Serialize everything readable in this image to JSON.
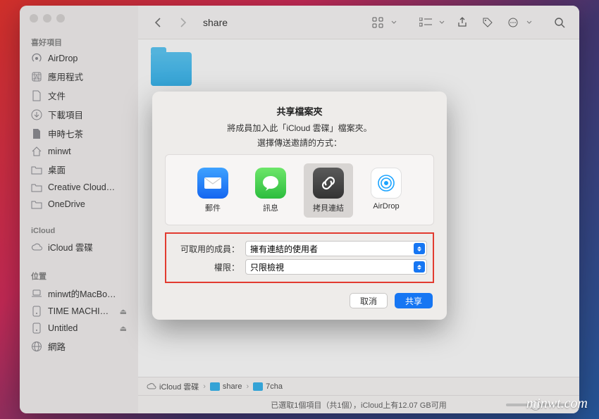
{
  "window": {
    "title": "share"
  },
  "sidebar": {
    "favorites_header": "喜好項目",
    "favorites": [
      {
        "icon": "airdrop",
        "label": "AirDrop"
      },
      {
        "icon": "apps",
        "label": "應用程式"
      },
      {
        "icon": "doc",
        "label": "文件"
      },
      {
        "icon": "downloads",
        "label": "下載項目"
      },
      {
        "icon": "doc-filled",
        "label": "申時七茶"
      },
      {
        "icon": "house",
        "label": "minwt"
      },
      {
        "icon": "folder",
        "label": "桌面"
      },
      {
        "icon": "folder",
        "label": "Creative Cloud…"
      },
      {
        "icon": "folder",
        "label": "OneDrive"
      }
    ],
    "icloud_header": "iCloud",
    "icloud": [
      {
        "icon": "cloud",
        "label": "iCloud 雲碟"
      }
    ],
    "locations_header": "位置",
    "locations": [
      {
        "icon": "laptop",
        "label": "minwt的MacBo…"
      },
      {
        "icon": "disk",
        "label": "TIME MACHI…",
        "eject": true
      },
      {
        "icon": "disk",
        "label": "Untitled",
        "eject": true
      },
      {
        "icon": "globe",
        "label": "網路"
      }
    ]
  },
  "pathbar": {
    "crumbs": [
      {
        "icon": "cloud",
        "label": "iCloud 雲碟"
      },
      {
        "icon": "folder",
        "label": "share"
      },
      {
        "icon": "folder",
        "label": "7cha"
      }
    ]
  },
  "status": {
    "text": "已選取1個項目（共1個），iCloud上有12.07 GB可用"
  },
  "dialog": {
    "title": "共享檔案夾",
    "subtitle1": "將成員加入此「iCloud 雲碟」檔案夾。",
    "subtitle2": "選擇傳送邀請的方式：",
    "options": [
      {
        "key": "mail",
        "label": "郵件"
      },
      {
        "key": "messages",
        "label": "訊息"
      },
      {
        "key": "copylink",
        "label": "拷貝連結",
        "selected": true
      },
      {
        "key": "airdrop",
        "label": "AirDrop"
      }
    ],
    "access_label": "可取用的成員：",
    "access_value": "擁有連結的使用者",
    "perm_label": "權限：",
    "perm_value": "只限檢視",
    "cancel": "取消",
    "share": "共享"
  },
  "watermark": "minwt.com"
}
